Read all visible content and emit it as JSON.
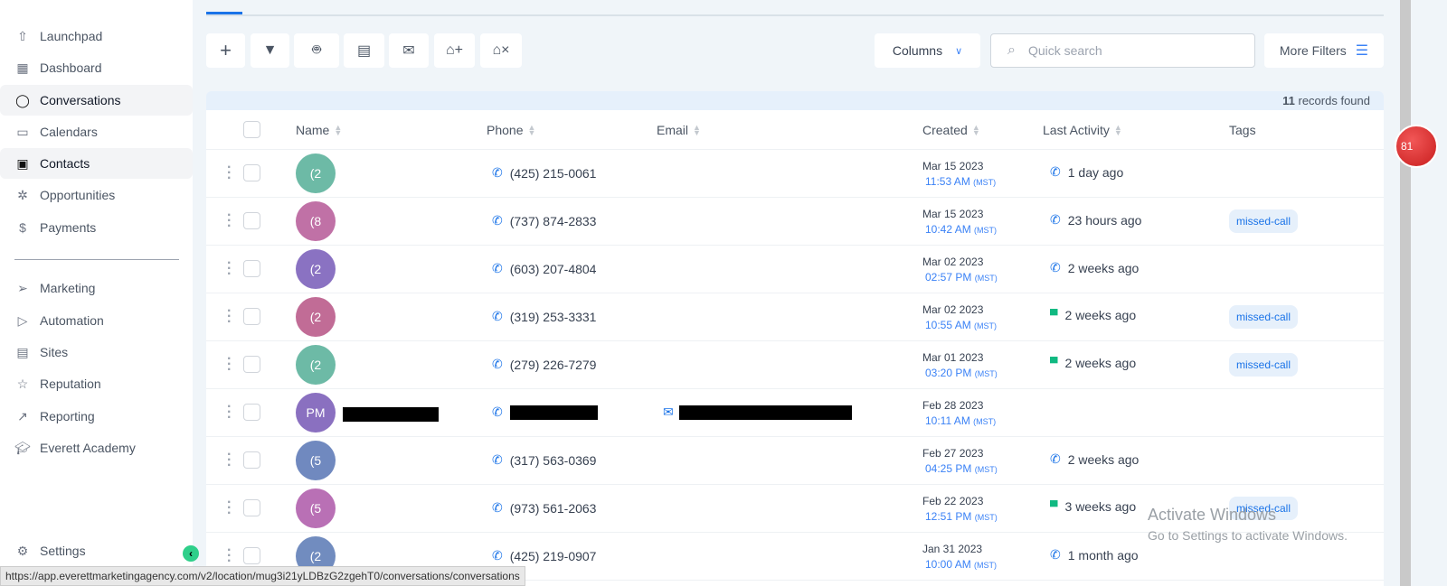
{
  "sidebar": {
    "items": [
      {
        "label": "Launchpad",
        "icon": "launchpad-icon"
      },
      {
        "label": "Dashboard",
        "icon": "dashboard-icon"
      },
      {
        "label": "Conversations",
        "icon": "chat-icon",
        "active": true
      },
      {
        "label": "Calendars",
        "icon": "calendar-icon"
      },
      {
        "label": "Contacts",
        "icon": "contacts-icon",
        "active": true
      },
      {
        "label": "Opportunities",
        "icon": "opportunities-icon"
      },
      {
        "label": "Payments",
        "icon": "payments-icon"
      },
      {
        "label": "Marketing",
        "icon": "send-icon"
      },
      {
        "label": "Automation",
        "icon": "automation-icon"
      },
      {
        "label": "Sites",
        "icon": "sites-icon"
      },
      {
        "label": "Reputation",
        "icon": "star-icon"
      },
      {
        "label": "Reporting",
        "icon": "reporting-icon"
      },
      {
        "label": "Everett Academy",
        "icon": "academy-icon"
      }
    ],
    "settings": "Settings"
  },
  "toolbar": {
    "columns": "Columns",
    "search_placeholder": "Quick search",
    "more_filters": "More Filters"
  },
  "records": {
    "count": "11",
    "label": " records found"
  },
  "table": {
    "headers": {
      "name": "Name",
      "phone": "Phone",
      "email": "Email",
      "created": "Created",
      "last_activity": "Last Activity",
      "tags": "Tags"
    },
    "rows": [
      {
        "initials": "(2",
        "color": "#6dbaa6",
        "phone": "(425) 215-0061",
        "date": "Mar 15 2023",
        "time": "11:53 AM",
        "tz": "(MST)",
        "activity": "1 day ago",
        "activity_type": "call",
        "tag": ""
      },
      {
        "initials": "(8",
        "color": "#c071a6",
        "phone": "(737) 874-2833",
        "date": "Mar 15 2023",
        "time": "10:42 AM",
        "tz": "(MST)",
        "activity": "23 hours ago",
        "activity_type": "call",
        "tag": "missed-call"
      },
      {
        "initials": "(2",
        "color": "#8a72c2",
        "phone": "(603) 207-4804",
        "date": "Mar 02 2023",
        "time": "02:57 PM",
        "tz": "(MST)",
        "activity": "2 weeks ago",
        "activity_type": "call",
        "tag": ""
      },
      {
        "initials": "(2",
        "color": "#c16c96",
        "phone": "(319) 253-3331",
        "date": "Mar 02 2023",
        "time": "10:55 AM",
        "tz": "(MST)",
        "activity": "2 weeks ago",
        "activity_type": "sms",
        "tag": "missed-call"
      },
      {
        "initials": "(2",
        "color": "#6dbaa6",
        "phone": "(279) 226-7279",
        "date": "Mar 01 2023",
        "time": "03:20 PM",
        "tz": "(MST)",
        "activity": "2 weeks ago",
        "activity_type": "sms",
        "tag": "missed-call"
      },
      {
        "initials": "PM",
        "color": "#8a70c0",
        "phone": "",
        "redacted": true,
        "date": "Feb 28 2023",
        "time": "10:11 AM",
        "tz": "(MST)",
        "activity": "",
        "activity_type": "",
        "tag": ""
      },
      {
        "initials": "(5",
        "color": "#7089bf",
        "phone": "(317) 563-0369",
        "date": "Feb 27 2023",
        "time": "04:25 PM",
        "tz": "(MST)",
        "activity": "2 weeks ago",
        "activity_type": "call",
        "tag": ""
      },
      {
        "initials": "(5",
        "color": "#b970b5",
        "phone": "(973) 561-2063",
        "date": "Feb 22 2023",
        "time": "12:51 PM",
        "tz": "(MST)",
        "activity": "3 weeks ago",
        "activity_type": "sms",
        "tag": "missed-call"
      },
      {
        "initials": "(2",
        "color": "#718cbf",
        "phone": "(425) 219-0907",
        "date": "Jan 31 2023",
        "time": "10:00 AM",
        "tz": "(MST)",
        "activity": "1 month ago",
        "activity_type": "call",
        "tag": ""
      }
    ]
  },
  "notification_badge": "81",
  "status_url": "https://app.everettmarketingagency.com/v2/location/mug3i21yLDBzG2zgehT0/conversations/conversations",
  "watermark": {
    "title": "Activate Windows",
    "subtitle": "Go to Settings to activate Windows."
  }
}
